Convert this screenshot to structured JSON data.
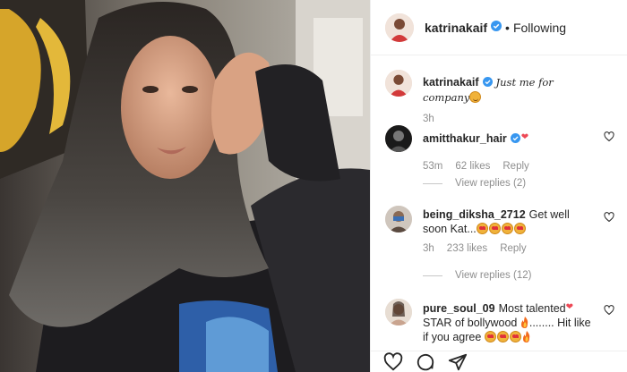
{
  "post": {
    "author": "katrinakaif",
    "follow_status": "Following",
    "separator": "•",
    "caption": "Just me for company",
    "caption_time": "3h",
    "verified_icon": "verified-badge-icon"
  },
  "comments": [
    {
      "username": "amitthakur_hair",
      "text": "",
      "time": "53m",
      "likes": "62 likes",
      "reply_label": "Reply",
      "view_replies": "View replies (2)"
    },
    {
      "username": "being_diksha_2712",
      "text": "Get well soon Kat...",
      "time": "3h",
      "likes": "233 likes",
      "reply_label": "Reply",
      "view_replies": "View replies (12)"
    },
    {
      "username": "pure_soul_09",
      "text_1": "Most talented",
      "text_2": "STAR of bollywood",
      "text_3": "........ Hit like",
      "text_4": "if you agree"
    }
  ],
  "colors": {
    "verified": "#3897f0",
    "like_heart": "#ed4956",
    "muted_text": "#8e8e8e"
  },
  "icons": [
    "heart-icon",
    "comment-icon",
    "share-icon",
    "like-comment-icon"
  ]
}
